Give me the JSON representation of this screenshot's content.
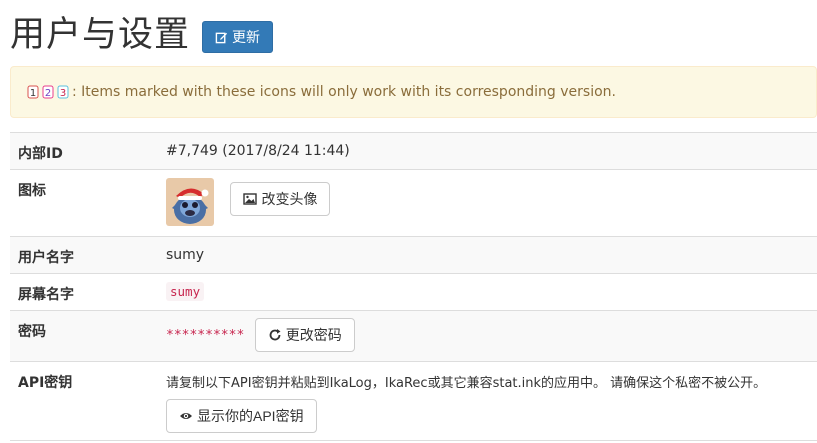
{
  "header": {
    "title": "用户与设置",
    "update_label": "更新"
  },
  "alert": {
    "icons": [
      "version-1-icon",
      "version-2-icon",
      "version-3-icon"
    ],
    "text": ": Items marked with these icons will only work with its corresponding version."
  },
  "rows": {
    "internal_id": {
      "label": "内部ID",
      "value": "#7,749 (2017/8/24 11:44)"
    },
    "icon": {
      "label": "图标",
      "change_avatar_label": "改变头像"
    },
    "username": {
      "label": "用户名字",
      "value": "sumy"
    },
    "screen_name": {
      "label": "屏幕名字",
      "value": "sumy"
    },
    "password": {
      "label": "密码",
      "mask": "**********",
      "change_label": "更改密码"
    },
    "api_key": {
      "label": "API密钥",
      "description": "请复制以下API密钥并粘贴到IkaLog，IkaRec或其它兼容stat.ink的应用中。 请确保这个私密不被公开。",
      "show_label": "显示你的API密钥"
    }
  },
  "colors": {
    "primary": "#337ab7",
    "alert_bg": "#fcf8e3",
    "alert_text": "#8a6d3b",
    "code_pink": "#c7254e"
  }
}
